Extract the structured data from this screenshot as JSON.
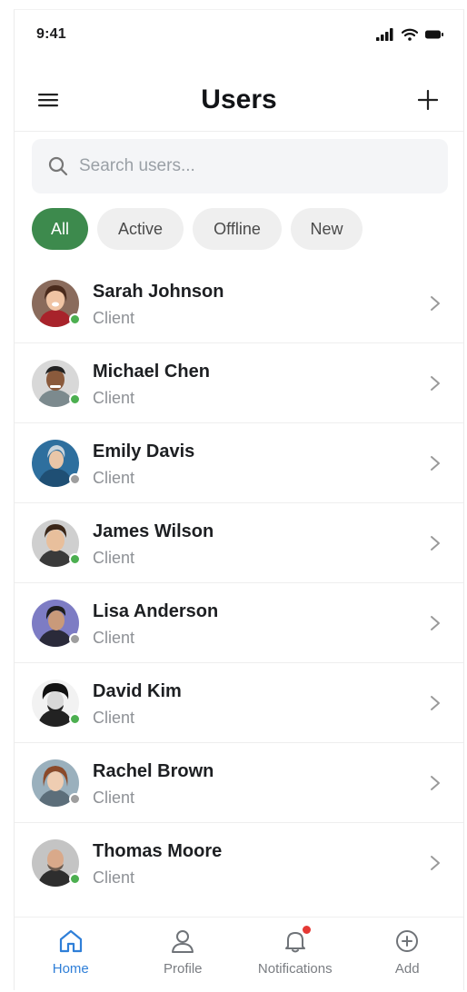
{
  "status_bar": {
    "time": "9:41"
  },
  "header": {
    "title": "Users"
  },
  "search": {
    "placeholder": "Search users..."
  },
  "filters": [
    {
      "label": "All",
      "active": true
    },
    {
      "label": "Active",
      "active": false
    },
    {
      "label": "Offline",
      "active": false
    },
    {
      "label": "New",
      "active": false
    }
  ],
  "users": [
    {
      "name": "Sarah Johnson",
      "role": "Client",
      "status": "online"
    },
    {
      "name": "Michael Chen",
      "role": "Client",
      "status": "online"
    },
    {
      "name": "Emily Davis",
      "role": "Client",
      "status": "offline"
    },
    {
      "name": "James Wilson",
      "role": "Client",
      "status": "online"
    },
    {
      "name": "Lisa Anderson",
      "role": "Client",
      "status": "offline"
    },
    {
      "name": "David Kim",
      "role": "Client",
      "status": "online"
    },
    {
      "name": "Rachel Brown",
      "role": "Client",
      "status": "offline"
    },
    {
      "name": "Thomas Moore",
      "role": "Client",
      "status": "online"
    }
  ],
  "bottom_nav": [
    {
      "label": "Home",
      "icon": "home-icon",
      "active": true
    },
    {
      "label": "Profile",
      "icon": "profile-icon",
      "active": false
    },
    {
      "label": "Notifications",
      "icon": "bell-icon",
      "active": false,
      "badge": true
    },
    {
      "label": "Add",
      "icon": "plus-circle-icon",
      "active": false
    }
  ],
  "colors": {
    "accent": "#3d8a4d",
    "nav_active": "#2f7fd8",
    "online": "#4caf50",
    "offline": "#9e9e9e",
    "badge": "#e53935"
  }
}
